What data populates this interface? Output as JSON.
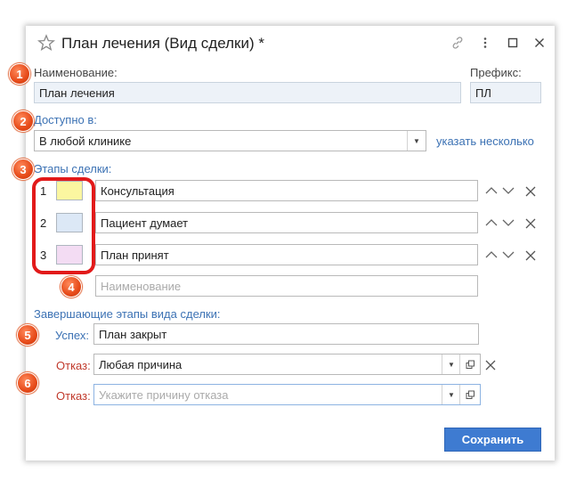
{
  "window": {
    "title": "План лечения (Вид сделки) *",
    "icons": [
      "star-icon",
      "link-icon",
      "more-icon",
      "maximize-icon",
      "close-icon"
    ]
  },
  "form": {
    "name_label": "Наименование:",
    "name_value": "План лечения",
    "prefix_label": "Префикс:",
    "prefix_value": "ПЛ",
    "available_label": "Доступно в:",
    "available_value": "В любой клинике",
    "available_link": "указать несколько",
    "stages_label": "Этапы сделки:",
    "stages": [
      {
        "num": "1",
        "name": "Консультация",
        "color": "#fbf6a0"
      },
      {
        "num": "2",
        "name": "Пациент думает",
        "color": "#dce8f6"
      },
      {
        "num": "3",
        "name": "План принят",
        "color": "#f3dcf3"
      }
    ],
    "new_stage_placeholder": "Наименование",
    "final_label": "Завершающие этапы вида сделки:",
    "success_label": "Успех:",
    "success_value": "План закрыт",
    "fail_label": "Отказ:",
    "fail_value": "Любая причина",
    "fail2_label": "Отказ:",
    "fail2_placeholder": "Укажите причину отказа",
    "save_label": "Сохранить"
  },
  "badges": [
    "1",
    "2",
    "3",
    "4",
    "5",
    "6"
  ],
  "colors": {
    "accent": "#3e7bd1",
    "link": "#3c72b4",
    "danger": "#c0392b",
    "badge": "#e64a19",
    "highlight": "#e21a1a"
  }
}
